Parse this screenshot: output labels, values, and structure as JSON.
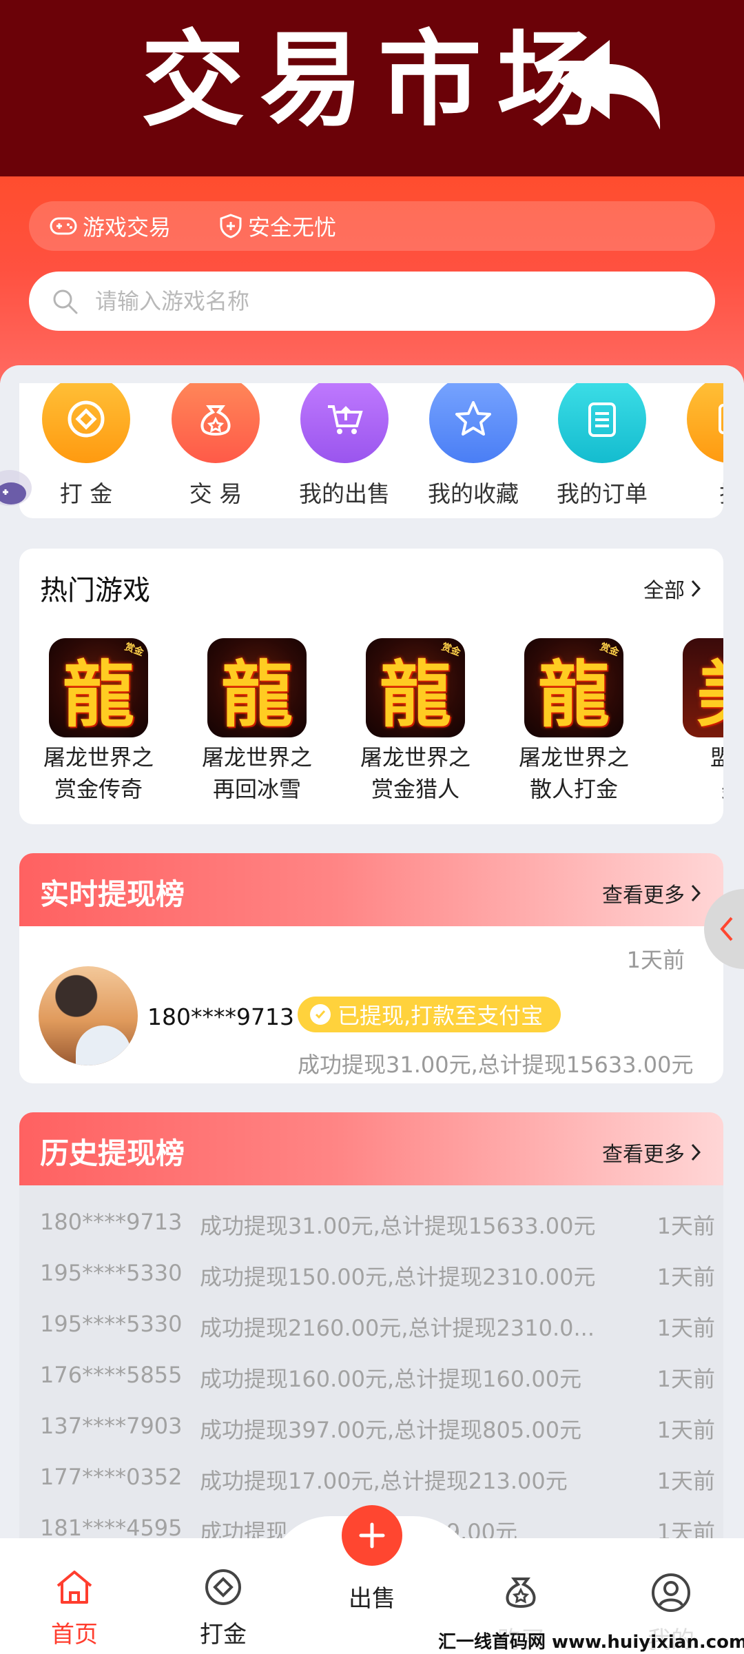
{
  "banner": {
    "title": "交易市场"
  },
  "header": {
    "tags": [
      {
        "label": "游戏交易",
        "icon": "gamepad-icon"
      },
      {
        "label": "安全无忧",
        "icon": "shield-plus-icon"
      }
    ],
    "search": {
      "placeholder": "请输入游戏名称",
      "icon": "search-icon"
    }
  },
  "menu": {
    "items": [
      {
        "label": "打 金",
        "icon": "coin-icon",
        "color": "#ffa21f"
      },
      {
        "label": "交 易",
        "icon": "money-bag-icon",
        "color": "#ff6a4d"
      },
      {
        "label": "我的出售",
        "icon": "cart-icon",
        "color": "#b06af0"
      },
      {
        "label": "我的收藏",
        "icon": "star-icon",
        "color": "#5a8cf8"
      },
      {
        "label": "我的订单",
        "icon": "order-list-icon",
        "color": "#22c7d8"
      },
      {
        "label": "提",
        "icon": "withdraw-icon",
        "color": "#ffa21f"
      }
    ]
  },
  "hot_games": {
    "title": "热门游戏",
    "more": "全部",
    "games": [
      {
        "line1": "屠龙世界之",
        "line2": "赏金传奇",
        "glyph": "龍",
        "stamp": "赏金"
      },
      {
        "line1": "屠龙世界之",
        "line2": "再回冰雪",
        "glyph": "龍",
        "stamp": ""
      },
      {
        "line1": "屠龙世界之",
        "line2": "赏金猎人",
        "glyph": "龍",
        "stamp": "赏金"
      },
      {
        "line1": "屠龙世界之",
        "line2": "散人打金",
        "glyph": "龍",
        "stamp": "赏金"
      },
      {
        "line1": "盟重",
        "line2": "美",
        "glyph": "美",
        "stamp": ""
      }
    ]
  },
  "realtime": {
    "title": "实时提现榜",
    "more": "查看更多",
    "entry": {
      "phone": "180****9713",
      "time": "1天前",
      "badge": "已提现,打款至支付宝",
      "detail": "成功提现31.00元,总计提现15633.00元"
    }
  },
  "history": {
    "title": "历史提现榜",
    "more": "查看更多",
    "rows": [
      {
        "phone": "180****9713",
        "detail": "成功提现31.00元,总计提现15633.00元",
        "time": "1天前"
      },
      {
        "phone": "195****5330",
        "detail": "成功提现150.00元,总计提现2310.00元",
        "time": "1天前"
      },
      {
        "phone": "195****5330",
        "detail": "成功提现2160.00元,总计提现2310.0...",
        "time": "1天前"
      },
      {
        "phone": "176****5855",
        "detail": "成功提现160.00元,总计提现160.00元",
        "time": "1天前"
      },
      {
        "phone": "137****7903",
        "detail": "成功提现397.00元,总计提现805.00元",
        "time": "1天前"
      },
      {
        "phone": "177****0352",
        "detail": "成功提现17.00元,总计提现213.00元",
        "time": "1天前"
      },
      {
        "phone": "181****4595",
        "detail": "成功提现...,总计提现2699.00元",
        "time": "1天前"
      }
    ]
  },
  "tabbar": {
    "tabs": [
      {
        "label": "首页",
        "icon": "home-icon",
        "active": true
      },
      {
        "label": "打金",
        "icon": "coin-icon",
        "active": false
      },
      {
        "label": "出售",
        "icon": "plus-icon",
        "active": false
      },
      {
        "label": "购买",
        "icon": "money-bag-icon",
        "active": false
      },
      {
        "label": "我的",
        "icon": "user-icon",
        "active": false
      }
    ]
  },
  "watermark": "汇一线首码网 www.huiyixian.com",
  "colors": {
    "brand_red": "#ff4630",
    "banner_bg": "#6b0208",
    "badge_yellow": "#ffd23c"
  }
}
